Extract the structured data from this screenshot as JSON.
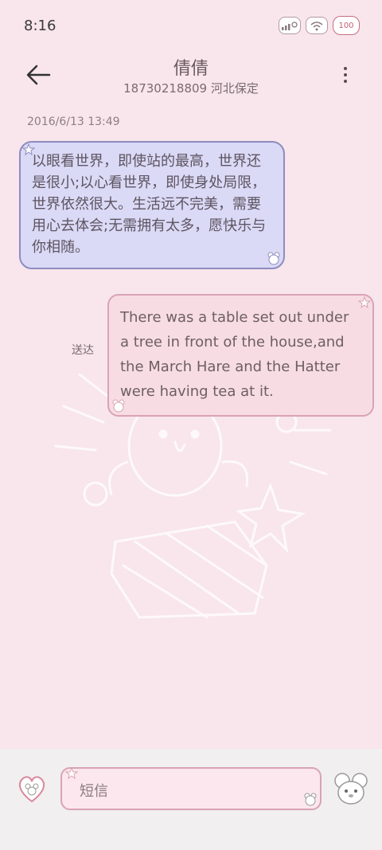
{
  "status_bar": {
    "time": "8:16",
    "battery": "100"
  },
  "header": {
    "contact_name": "倩倩",
    "contact_info": "18730218809 河北保定"
  },
  "conversation": {
    "timestamp": "2016/6/13 13:49",
    "incoming_message": "以眼看世界，即使站的最高，世界还是很小;以心看世界，即使身处局限，世界依然很大。生活远不完美，需要用心去体会;无需拥有太多，愿快乐与你相随。",
    "outgoing_message": "There was a table set out under a tree in front of the house,and the March Hare and the Hatter were having tea at it.",
    "delivery_status": "送达"
  },
  "compose": {
    "placeholder": "短信"
  },
  "colors": {
    "background": "#f8e6ec",
    "incoming_bubble": "#dad9f6",
    "incoming_border": "#8e8cbf",
    "outgoing_bubble": "#f7dce4",
    "outgoing_border": "#d9a3b4",
    "compose_bar": "#f1eff0"
  },
  "icons": {
    "back": "back-arrow-icon",
    "menu": "more-vertical-icon",
    "sticker": "heart-mouse-sticker-icon",
    "send": "mouse-face-send-icon"
  }
}
